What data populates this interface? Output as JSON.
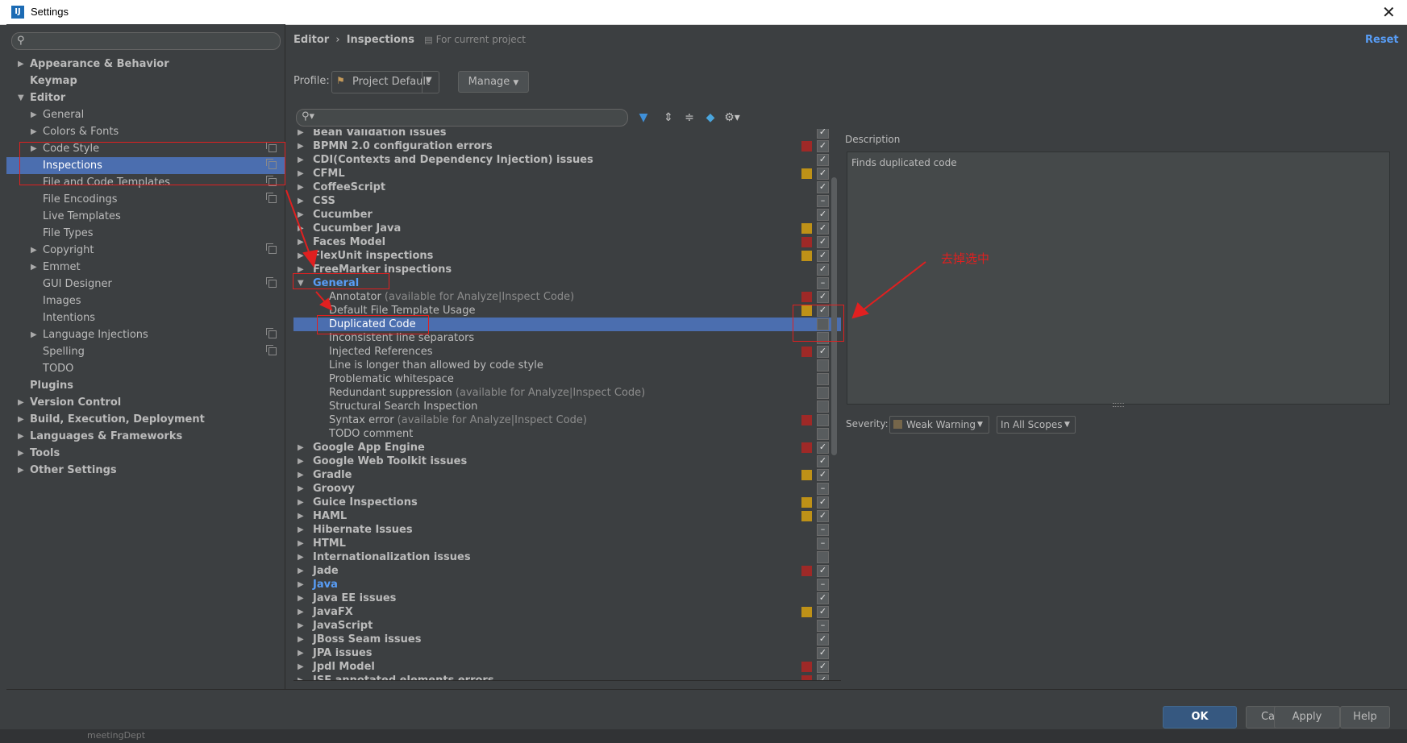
{
  "window": {
    "title": "Settings",
    "logo": "IJ"
  },
  "sidebar": {
    "search_placeholder": "",
    "items": [
      {
        "label": "Appearance & Behavior",
        "level": 0,
        "arrow": "▶",
        "bold": true
      },
      {
        "label": "Keymap",
        "level": 0,
        "arrow": "",
        "bold": true
      },
      {
        "label": "Editor",
        "level": 0,
        "arrow": "▼",
        "bold": true
      },
      {
        "label": "General",
        "level": 1,
        "arrow": "▶"
      },
      {
        "label": "Colors & Fonts",
        "level": 1,
        "arrow": "▶"
      },
      {
        "label": "Code Style",
        "level": 1,
        "arrow": "▶",
        "copy": true
      },
      {
        "label": "Inspections",
        "level": 1,
        "arrow": "",
        "copy": true,
        "selected": true
      },
      {
        "label": "File and Code Templates",
        "level": 1,
        "arrow": "",
        "copy": true
      },
      {
        "label": "File Encodings",
        "level": 1,
        "arrow": "",
        "copy": true
      },
      {
        "label": "Live Templates",
        "level": 1,
        "arrow": ""
      },
      {
        "label": "File Types",
        "level": 1,
        "arrow": ""
      },
      {
        "label": "Copyright",
        "level": 1,
        "arrow": "▶",
        "copy": true
      },
      {
        "label": "Emmet",
        "level": 1,
        "arrow": "▶"
      },
      {
        "label": "GUI Designer",
        "level": 1,
        "arrow": "",
        "copy": true
      },
      {
        "label": "Images",
        "level": 1,
        "arrow": ""
      },
      {
        "label": "Intentions",
        "level": 1,
        "arrow": ""
      },
      {
        "label": "Language Injections",
        "level": 1,
        "arrow": "▶",
        "copy": true
      },
      {
        "label": "Spelling",
        "level": 1,
        "arrow": "",
        "copy": true
      },
      {
        "label": "TODO",
        "level": 1,
        "arrow": ""
      },
      {
        "label": "Plugins",
        "level": 0,
        "arrow": "",
        "bold": true
      },
      {
        "label": "Version Control",
        "level": 0,
        "arrow": "▶",
        "bold": true
      },
      {
        "label": "Build, Execution, Deployment",
        "level": 0,
        "arrow": "▶",
        "bold": true
      },
      {
        "label": "Languages & Frameworks",
        "level": 0,
        "arrow": "▶",
        "bold": true
      },
      {
        "label": "Tools",
        "level": 0,
        "arrow": "▶",
        "bold": true
      },
      {
        "label": "Other Settings",
        "level": 0,
        "arrow": "▶",
        "bold": true
      }
    ]
  },
  "header": {
    "crumb_1": "Editor",
    "crumb_sep": "›",
    "crumb_2": "Inspections",
    "scope_note": "For current project",
    "reset_label": "Reset"
  },
  "profile": {
    "label": "Profile:",
    "value": "Project Default",
    "manage_label": "Manage"
  },
  "toolbar": {
    "filter_icon": "funnel-icon",
    "expand_icon": "expand-all-icon",
    "collapse_icon": "collapse-all-icon",
    "reset_icon": "eraser-icon",
    "gear_icon": "gear-icon"
  },
  "colors": {
    "error": "#9e2927",
    "warning": "#be9117",
    "selection": "#4b6eaf",
    "link": "#589df6"
  },
  "inspections": [
    {
      "label": "Bean Validation issues",
      "group": true,
      "sev": "",
      "check": "on",
      "partial": true
    },
    {
      "label": "BPMN 2.0 configuration errors",
      "group": true,
      "sev": "error",
      "check": "on"
    },
    {
      "label": "CDI(Contexts and Dependency Injection) issues",
      "group": true,
      "sev": "",
      "check": "on"
    },
    {
      "label": "CFML",
      "group": true,
      "sev": "warning",
      "check": "on"
    },
    {
      "label": "CoffeeScript",
      "group": true,
      "sev": "",
      "check": "on"
    },
    {
      "label": "CSS",
      "group": true,
      "sev": "",
      "check": "mixed"
    },
    {
      "label": "Cucumber",
      "group": true,
      "sev": "",
      "check": "on"
    },
    {
      "label": "Cucumber Java",
      "group": true,
      "sev": "warning",
      "check": "on"
    },
    {
      "label": "Faces Model",
      "group": true,
      "sev": "error",
      "check": "on"
    },
    {
      "label": "FlexUnit inspections",
      "group": true,
      "sev": "warning",
      "check": "on"
    },
    {
      "label": "FreeMarker inspections",
      "group": true,
      "sev": "",
      "check": "on"
    },
    {
      "label": "General",
      "group": true,
      "expanded": true,
      "link": true,
      "sev": "",
      "check": "mixed"
    },
    {
      "label": "Annotator",
      "hint": " (available for Analyze|Inspect Code)",
      "group": false,
      "sev": "error",
      "check": "on"
    },
    {
      "label": "Default File Template Usage",
      "group": false,
      "sev": "warning",
      "check": "on"
    },
    {
      "label": "Duplicated Code",
      "group": false,
      "sev": "",
      "check": "off",
      "selected": true
    },
    {
      "label": "Inconsistent line separators",
      "group": false,
      "sev": "",
      "check": "off"
    },
    {
      "label": "Injected References",
      "group": false,
      "sev": "error",
      "check": "on"
    },
    {
      "label": "Line is longer than allowed by code style",
      "group": false,
      "sev": "",
      "check": "off"
    },
    {
      "label": "Problematic whitespace",
      "group": false,
      "sev": "",
      "check": "off"
    },
    {
      "label": "Redundant suppression",
      "hint": " (available for Analyze|Inspect Code)",
      "group": false,
      "sev": "",
      "check": "off"
    },
    {
      "label": "Structural Search Inspection",
      "group": false,
      "sev": "",
      "check": "off"
    },
    {
      "label": "Syntax error",
      "hint": " (available for Analyze|Inspect Code)",
      "group": false,
      "sev": "error",
      "check": "off"
    },
    {
      "label": "TODO comment",
      "group": false,
      "sev": "",
      "check": "off"
    },
    {
      "label": "Google App Engine",
      "group": true,
      "sev": "error",
      "check": "on"
    },
    {
      "label": "Google Web Toolkit issues",
      "group": true,
      "sev": "",
      "check": "on"
    },
    {
      "label": "Gradle",
      "group": true,
      "sev": "warning",
      "check": "on"
    },
    {
      "label": "Groovy",
      "group": true,
      "sev": "",
      "check": "mixed"
    },
    {
      "label": "Guice Inspections",
      "group": true,
      "sev": "warning",
      "check": "on"
    },
    {
      "label": "HAML",
      "group": true,
      "sev": "warning",
      "check": "on"
    },
    {
      "label": "Hibernate Issues",
      "group": true,
      "sev": "",
      "check": "mixed"
    },
    {
      "label": "HTML",
      "group": true,
      "sev": "",
      "check": "mixed"
    },
    {
      "label": "Internationalization issues",
      "group": true,
      "sev": "",
      "check": "off"
    },
    {
      "label": "Jade",
      "group": true,
      "sev": "error",
      "check": "on"
    },
    {
      "label": "Java",
      "group": true,
      "link": true,
      "sev": "",
      "check": "mixed"
    },
    {
      "label": "Java EE issues",
      "group": true,
      "sev": "",
      "check": "on"
    },
    {
      "label": "JavaFX",
      "group": true,
      "sev": "warning",
      "check": "on"
    },
    {
      "label": "JavaScript",
      "group": true,
      "sev": "",
      "check": "mixed"
    },
    {
      "label": "JBoss Seam issues",
      "group": true,
      "sev": "",
      "check": "on"
    },
    {
      "label": "JPA issues",
      "group": true,
      "sev": "",
      "check": "on"
    },
    {
      "label": "Jpdl Model",
      "group": true,
      "sev": "error",
      "check": "on"
    },
    {
      "label": "JSF annotated elements errors",
      "group": true,
      "sev": "error",
      "check": "on",
      "partial": true
    }
  ],
  "description": {
    "label": "Description",
    "text": "Finds duplicated code",
    "severity_label": "Severity:",
    "severity_value": "Weak Warning",
    "scope_value": "In All Scopes"
  },
  "buttons": {
    "ok": "OK",
    "cancel": "Cancel",
    "apply": "Apply",
    "help": "Help"
  },
  "annotation": {
    "text": "去掉选中"
  },
  "background": {
    "partial_text": "meetingDept"
  }
}
